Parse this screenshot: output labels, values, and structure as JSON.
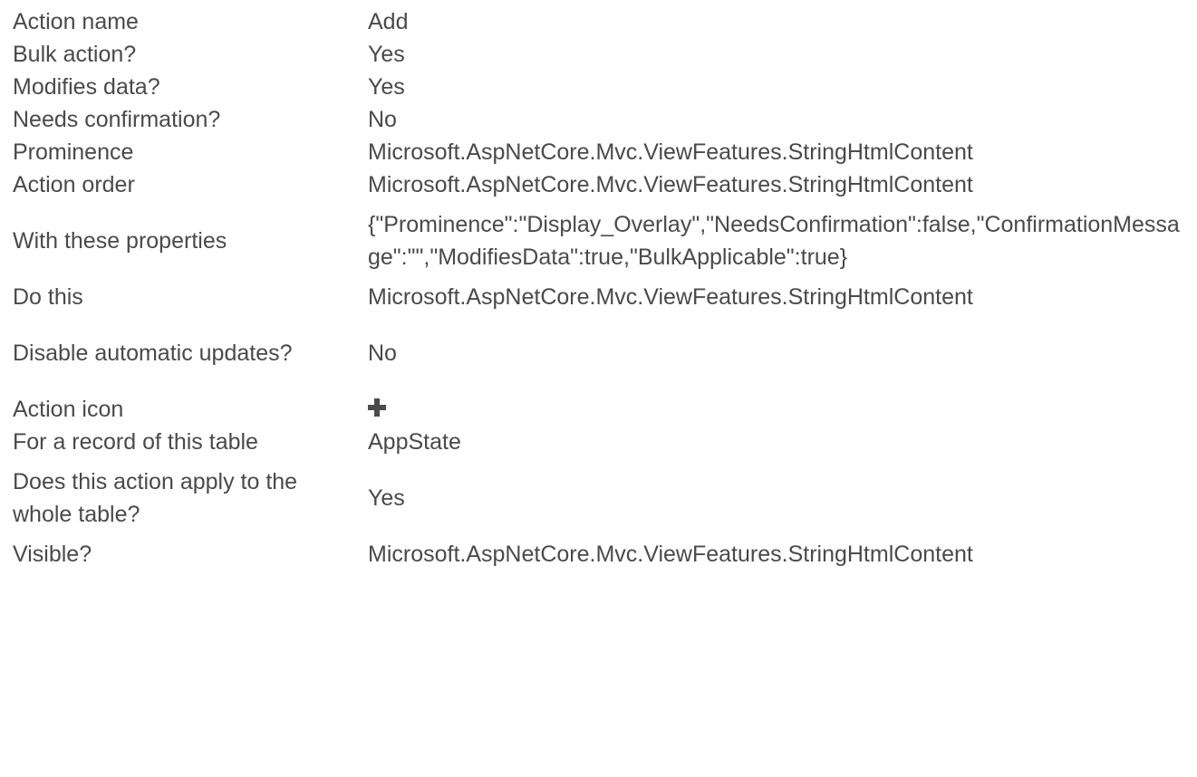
{
  "properties": [
    {
      "label": "Action name",
      "value": "Add"
    },
    {
      "label": "Bulk action?",
      "value": "Yes"
    },
    {
      "label": "Modifies data?",
      "value": "Yes"
    },
    {
      "label": "Needs confirmation?",
      "value": "No"
    },
    {
      "label": "Prominence",
      "value": "Microsoft.AspNetCore.Mvc.ViewFeatures.StringHtmlContent"
    },
    {
      "label": "Action order",
      "value": "Microsoft.AspNetCore.Mvc.ViewFeatures.StringHtmlContent"
    },
    {
      "label": "With these properties",
      "value": "{\"Prominence\":\"Display_Overlay\",\"NeedsConfirmation\":false,\"ConfirmationMessage\":\"\",\"ModifiesData\":true,\"BulkApplicable\":true}"
    },
    {
      "label": "Do this",
      "value": "Microsoft.AspNetCore.Mvc.ViewFeatures.StringHtmlContent"
    },
    {
      "label": "Disable automatic updates?",
      "value": "No"
    },
    {
      "label": "Action icon",
      "icon": "plus-icon"
    },
    {
      "label": "For a record of this table",
      "value": "AppState"
    },
    {
      "label": "Does this action apply to the whole table?",
      "value": "Yes"
    },
    {
      "label": "Visible?",
      "value": "Microsoft.AspNetCore.Mvc.ViewFeatures.StringHtmlContent"
    }
  ]
}
